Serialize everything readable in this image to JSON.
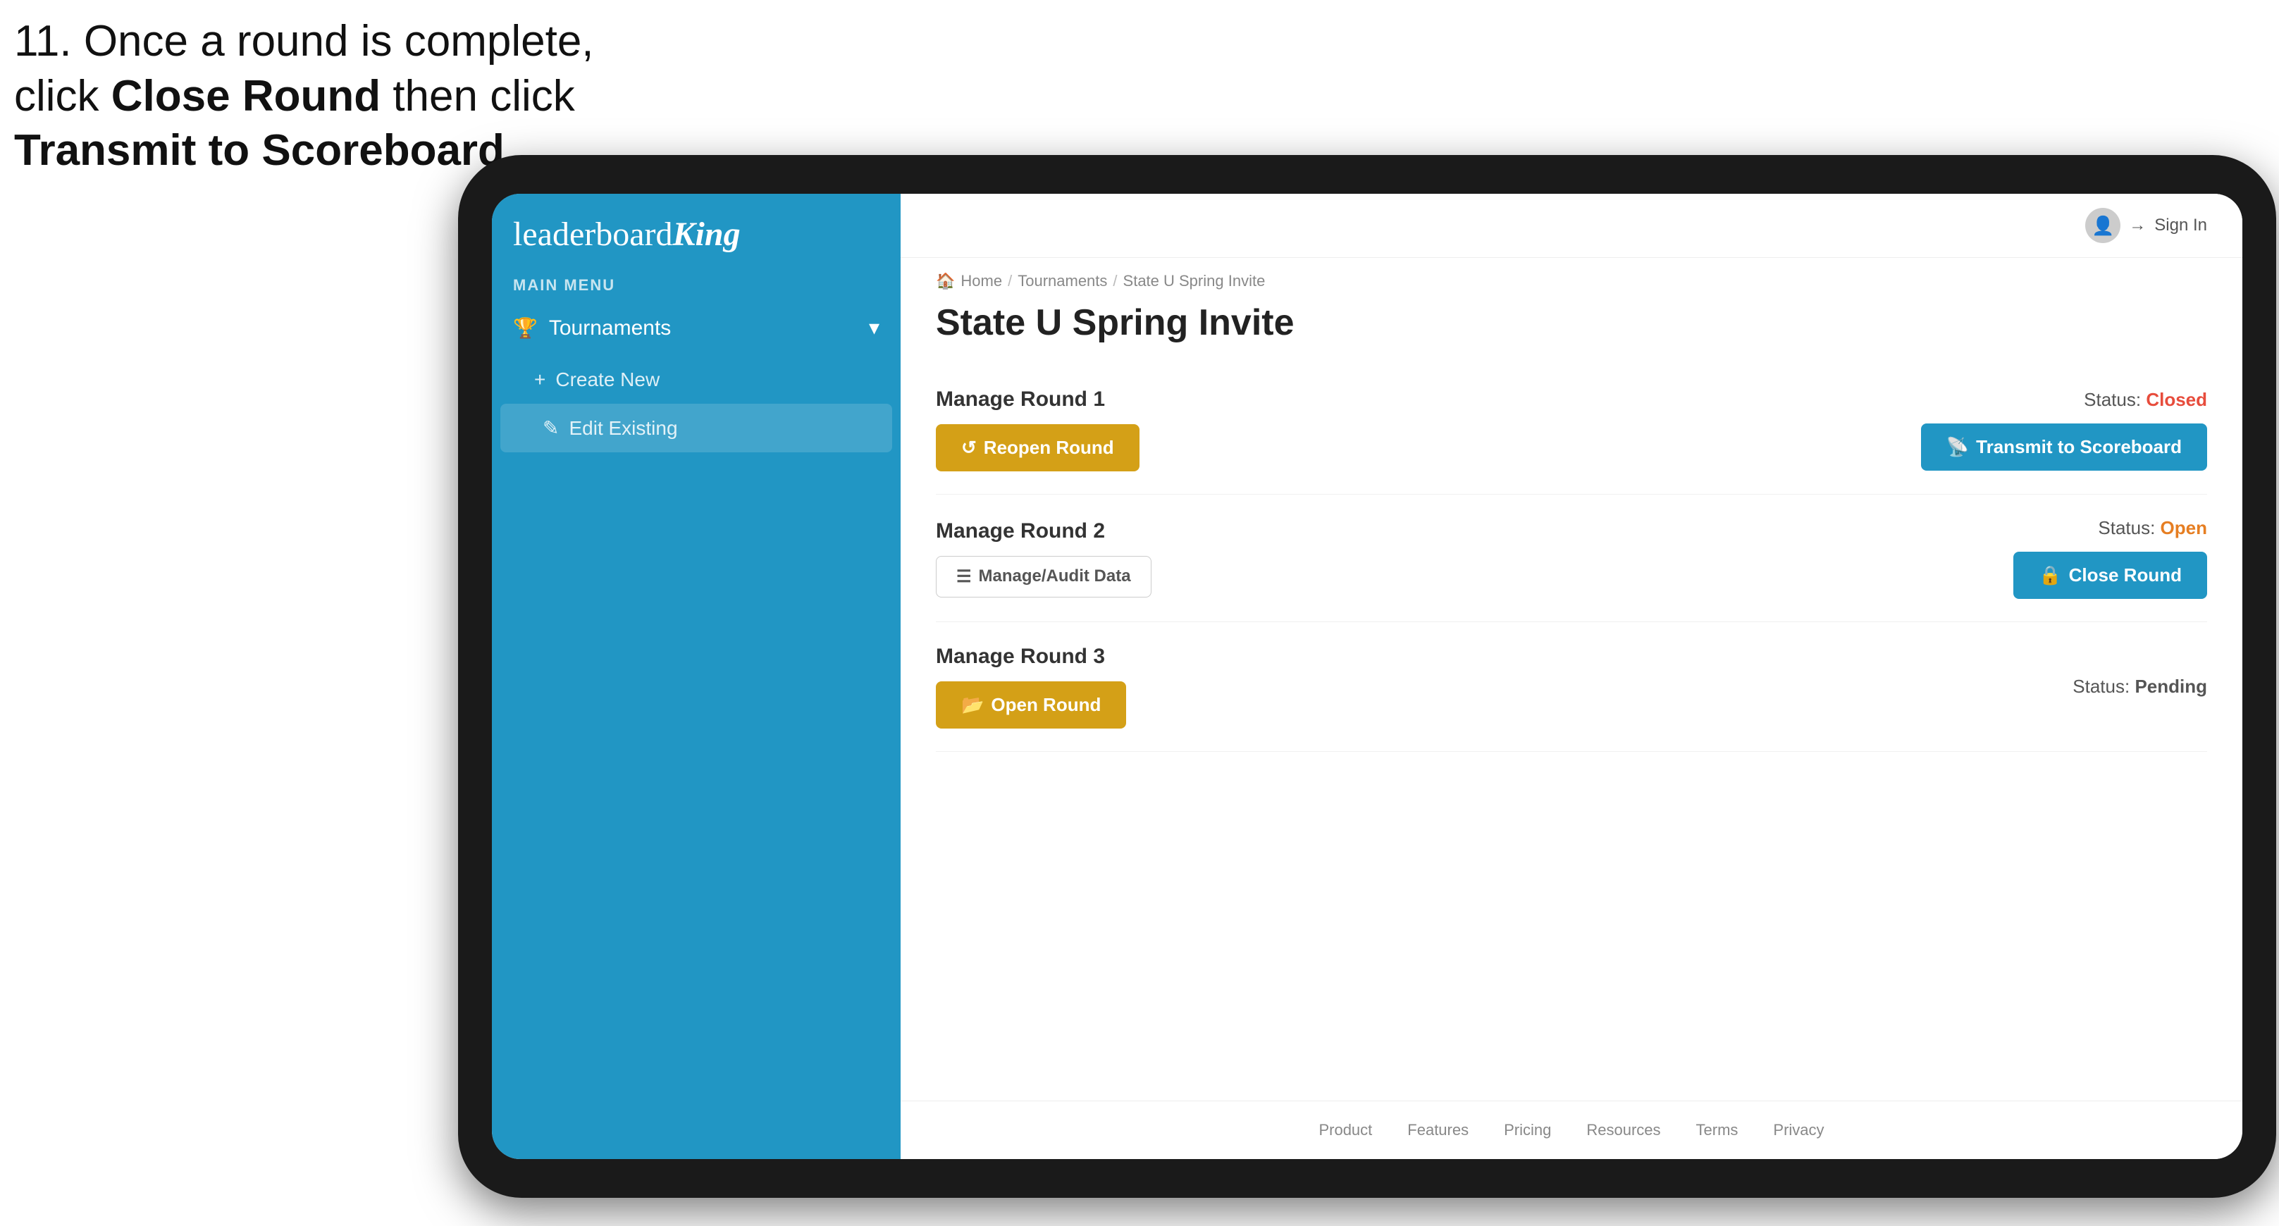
{
  "instruction": {
    "line1": "11. Once a round is complete,",
    "line2": "click ",
    "bold1": "Close Round",
    "line3": " then click",
    "bold2": "Transmit to Scoreboard."
  },
  "logo": {
    "text_leaderboard": "leaderboard",
    "text_king": "King"
  },
  "sidebar": {
    "main_menu_label": "MAIN MENU",
    "tournaments_label": "Tournaments",
    "create_new_label": "Create New",
    "edit_existing_label": "Edit Existing"
  },
  "header": {
    "sign_in_label": "Sign In"
  },
  "breadcrumb": {
    "home": "Home",
    "tournaments": "Tournaments",
    "current": "State U Spring Invite"
  },
  "page": {
    "title": "State U Spring Invite"
  },
  "rounds": [
    {
      "id": 1,
      "title": "Manage Round 1",
      "status_label": "Status:",
      "status_value": "Closed",
      "status_class": "status-closed",
      "primary_button_label": "Reopen Round",
      "primary_button_class": "btn-gold",
      "secondary_button_label": "Transmit to Scoreboard",
      "secondary_button_class": "btn-blue"
    },
    {
      "id": 2,
      "title": "Manage Round 2",
      "status_label": "Status:",
      "status_value": "Open",
      "status_class": "status-open",
      "primary_button_label": "Manage/Audit Data",
      "primary_button_class": "btn-outline",
      "secondary_button_label": "Close Round",
      "secondary_button_class": "btn-blue"
    },
    {
      "id": 3,
      "title": "Manage Round 3",
      "status_label": "Status:",
      "status_value": "Pending",
      "status_class": "status-pending",
      "primary_button_label": "Open Round",
      "primary_button_class": "btn-gold",
      "secondary_button_label": null,
      "secondary_button_class": null
    }
  ],
  "footer": {
    "links": [
      "Product",
      "Features",
      "Pricing",
      "Resources",
      "Terms",
      "Privacy"
    ]
  }
}
